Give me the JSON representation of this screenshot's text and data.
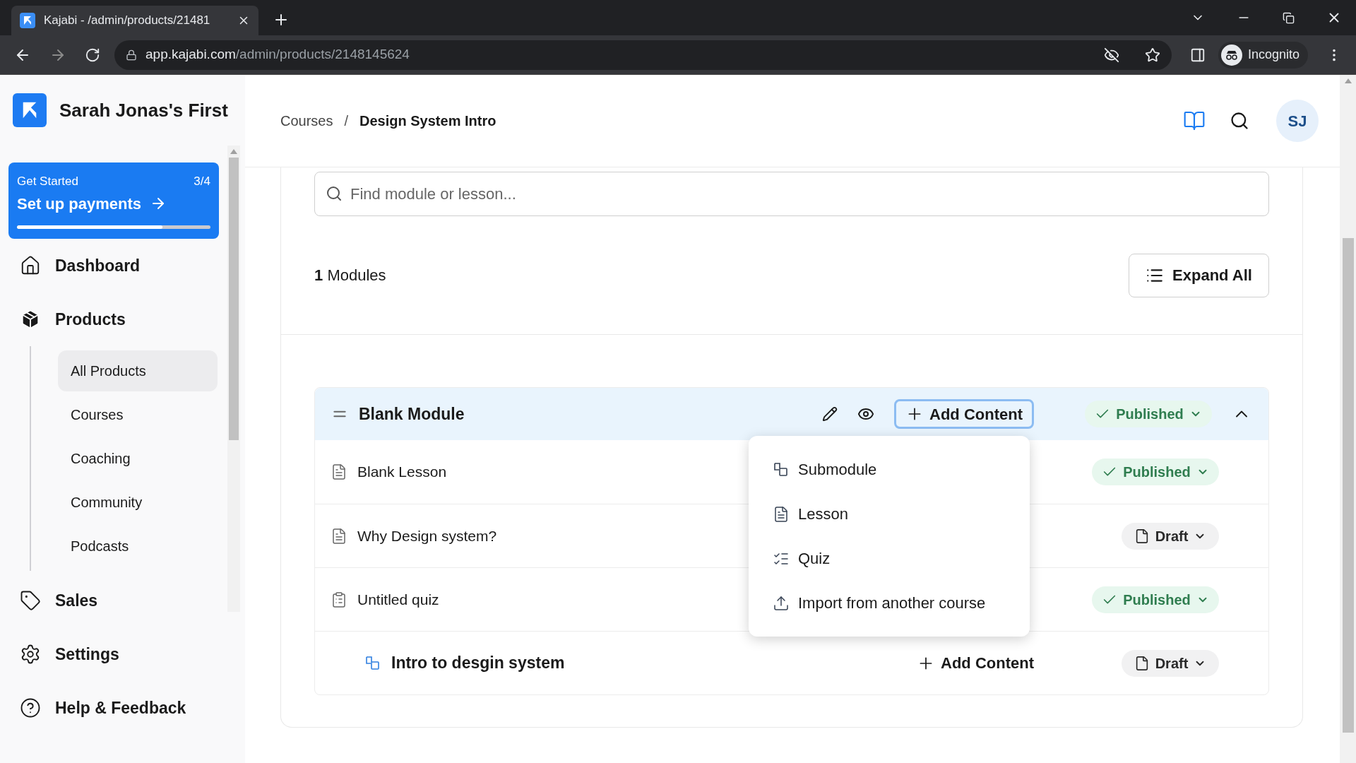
{
  "browser": {
    "tab_title": "Kajabi - /admin/products/21481",
    "url_host": "app.kajabi.com",
    "url_path": "/admin/products/2148145624",
    "profile": "Incognito"
  },
  "sidebar": {
    "site_name": "Sarah Jonas's First",
    "get_started": {
      "label": "Get Started",
      "count": "3/4",
      "title": "Set up payments",
      "level": 0.75
    },
    "nav": [
      {
        "label": "Dashboard"
      },
      {
        "label": "Products",
        "expanded": true,
        "children": [
          {
            "label": "All Products",
            "selected": true
          },
          {
            "label": "Courses",
            "selected": false
          },
          {
            "label": "Coaching",
            "selected": false
          },
          {
            "label": "Community",
            "selected": false
          },
          {
            "label": "Podcasts",
            "selected": false
          }
        ]
      },
      {
        "label": "Sales"
      },
      {
        "label": "Settings"
      },
      {
        "label": "Help & Feedback"
      }
    ]
  },
  "header": {
    "breadcrumbs": [
      "Courses",
      "Design System Intro"
    ],
    "breadcrumb_separator": "/",
    "avatar": "SJ"
  },
  "search": {
    "placeholder": "Find module or lesson..."
  },
  "modules_count": "1",
  "modules_label": "Modules",
  "expand_all": "Expand All",
  "module": {
    "title": "Blank Module",
    "add_content": "Add Content",
    "status": {
      "kind": "published",
      "label": "Published"
    },
    "expanded": true,
    "items": [
      {
        "kind": "lesson",
        "title": "Blank Lesson",
        "status": {
          "kind": "published",
          "label": "Published"
        }
      },
      {
        "kind": "lesson",
        "title": "Why Design system?",
        "status": {
          "kind": "draft",
          "label": "Draft"
        }
      },
      {
        "kind": "quiz",
        "title": "Untitled quiz",
        "status": {
          "kind": "published",
          "label": "Published"
        }
      },
      {
        "kind": "submodule",
        "title": "Intro to desgin system",
        "add_content": "Add Content",
        "status": {
          "kind": "draft",
          "label": "Draft"
        }
      }
    ]
  },
  "menu": {
    "items": [
      {
        "kind": "submodule",
        "label": "Submodule"
      },
      {
        "kind": "lesson",
        "label": "Lesson"
      },
      {
        "kind": "quiz",
        "label": "Quiz"
      },
      {
        "kind": "import",
        "label": "Import from another course"
      }
    ]
  }
}
